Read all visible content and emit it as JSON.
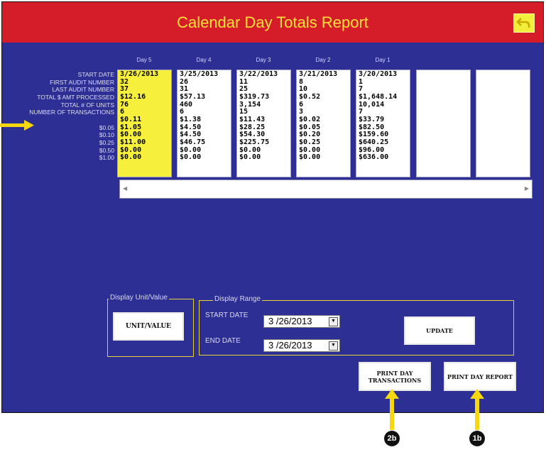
{
  "window": {
    "title": "Calendar Day Totals Report",
    "back_icon": "back-arrow-icon"
  },
  "days": [
    {
      "header": "Day 5",
      "values": [
        "3/26/2013",
        "32",
        "37",
        "$12.16",
        "76",
        "6",
        "$0.11",
        "$1.05",
        "$0.00",
        "$11.00",
        "$0.00",
        "$0.00"
      ]
    },
    {
      "header": "Day 4",
      "values": [
        "3/25/2013",
        "26",
        "31",
        "$57.13",
        "460",
        "6",
        "$1.38",
        "$4.50",
        "$4.50",
        "$46.75",
        "$0.00",
        "$0.00"
      ]
    },
    {
      "header": "Day 3",
      "values": [
        "3/22/2013",
        "11",
        "25",
        "$319.73",
        "3,154",
        "15",
        "$11.43",
        "$28.25",
        "$54.30",
        "$225.75",
        "$0.00",
        "$0.00"
      ]
    },
    {
      "header": "Day 2",
      "values": [
        "3/21/2013",
        "8",
        "10",
        "$0.52",
        "6",
        "3",
        "$0.02",
        "$0.05",
        "$0.20",
        "$0.25",
        "$0.00",
        "$0.00"
      ]
    },
    {
      "header": "Day 1",
      "values": [
        "3/20/2013",
        "1",
        "7",
        "$1,648.14",
        "10,014",
        "7",
        "$33.79",
        "$82.50",
        "$159.60",
        "$640.25",
        "$96.00",
        "$636.00"
      ]
    },
    {
      "header": "",
      "values": []
    },
    {
      "header": "",
      "values": []
    }
  ],
  "row_labels": [
    "START DATE",
    "FIRST AUDIT NUMBER",
    "LAST AUDIT NUMBER",
    "TOTAL $ AMT PROCESSED",
    "TOTAL # OF UNITS",
    "NUMBER OF TRANSACTIONS",
    "",
    "$0.05",
    "$0.10",
    "$0.25",
    "$0.50",
    "$1.00"
  ],
  "display_unit": {
    "group_label": "Display Unit/Value",
    "button_label": "UNIT/VALUE"
  },
  "display_range": {
    "group_label": "Display Range",
    "start_label": "START DATE",
    "start_value": "3 /26/2013",
    "end_label": "END DATE",
    "end_value": "3 /26/2013",
    "update_label": "UPDATE"
  },
  "print_transactions_label": "PRINT DAY\nTRANSACTIONS",
  "print_report_label": "PRINT DAY REPORT",
  "callouts": {
    "c1": "1b",
    "c2": "2b"
  },
  "colors": {
    "title_bar": "#d51d2a",
    "title_text": "#ffe23a",
    "background": "#2e2f95",
    "highlight": "#f6f03c",
    "pointer": "#f5d80f"
  }
}
